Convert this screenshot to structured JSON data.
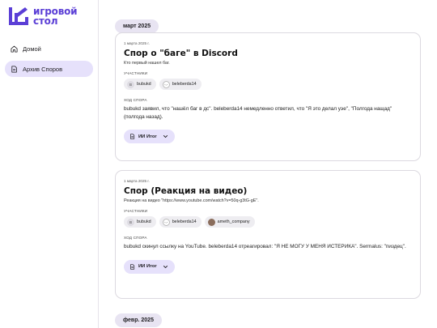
{
  "brand": {
    "line1": "игровой",
    "line2": "стол",
    "color": "#5b3fd6"
  },
  "nav": [
    {
      "label": "Домой",
      "icon": "home-icon",
      "active": false
    },
    {
      "label": "Архив Споров",
      "icon": "document-icon",
      "active": true
    }
  ],
  "months": [
    "март 2025",
    "февр. 2025"
  ],
  "cards": [
    {
      "date": "1 марта 2025 г.",
      "title": "Спор о \"баге\" в Discord",
      "description": "Кто первый нашел баг.",
      "participants_label": "УЧАСТНИКИ",
      "participants": [
        {
          "name": "bubukd",
          "avatar": "B"
        },
        {
          "name": "beleberda14",
          "avatar": "-.-"
        }
      ],
      "story_label": "ХОД СПОРА",
      "story": "bubukd заявил, что \"нашёл баг в дс\". beleberda14 немедленно ответил, что \"Я это делал уэе\", \"Полгода нащад\" (полгода назад).",
      "ai_label": "ИИ Итог"
    },
    {
      "date": "1 марта 2025 г.",
      "title": "Спор (Реакция на видео)",
      "description": "Реакция на видео \"https://www.youtube.com/watch?v=50q-g3tG-gE\".",
      "participants_label": "УЧАСТНИКИ",
      "participants": [
        {
          "name": "bubukd",
          "avatar": "B"
        },
        {
          "name": "beleberda14",
          "avatar": "-.-"
        },
        {
          "name": "ameth_company",
          "avatar": ""
        }
      ],
      "story_label": "ХОД СПОРА",
      "story": "bubukd скинул ссылку на YouTube. beleberda14 отреагировал: \"Я НЕ МОГУ У МЕНЯ ИСТЕРИКА\". Sermalus: \"пиздец\".",
      "ai_label": "ИИ Итог"
    }
  ]
}
